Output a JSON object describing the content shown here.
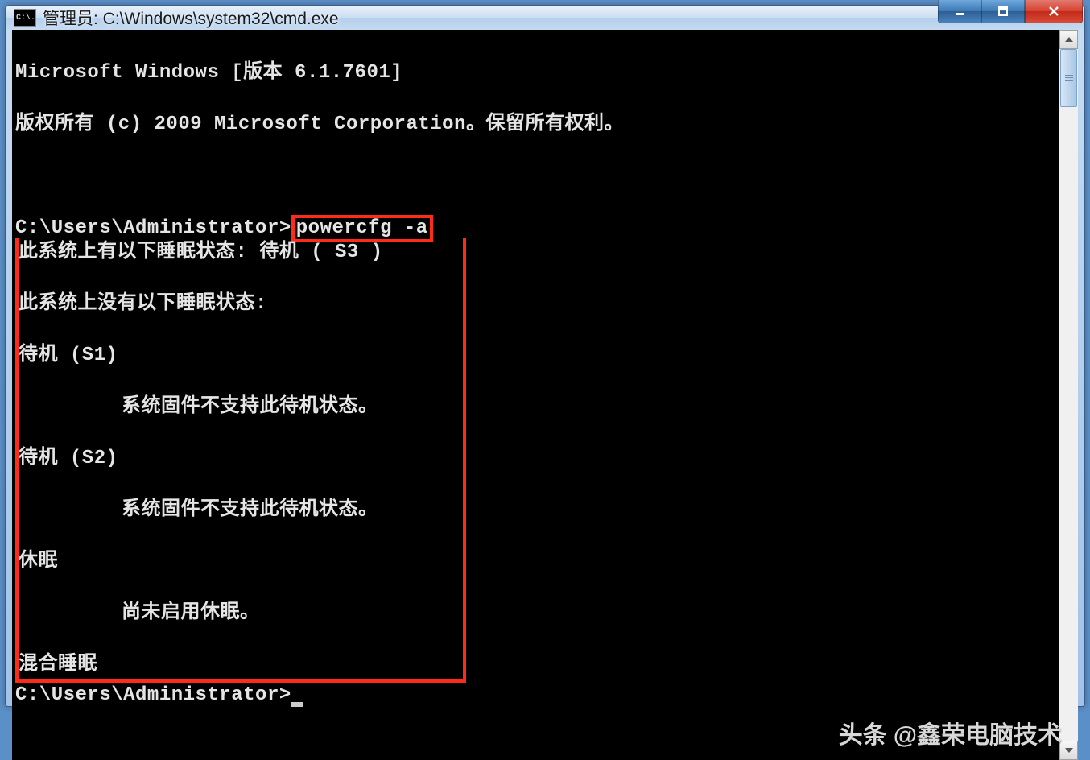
{
  "titlebar": {
    "icon_text": "C:\\.",
    "title": "管理员: C:\\Windows\\system32\\cmd.exe"
  },
  "console": {
    "line_version": "Microsoft Windows [版本 6.1.7601]",
    "line_copyright": "版权所有 (c) 2009 Microsoft Corporation。保留所有权利。",
    "prompt1_prefix": "C:\\Users\\Administrator>",
    "prompt1_command": "powercfg -a",
    "output": {
      "available_header": "此系统上有以下睡眠状态: 待机 ( S3 )",
      "unavailable_header": "此系统上没有以下睡眠状态:",
      "s1_label": "待机 (S1)",
      "s1_reason": "系统固件不支持此待机状态。",
      "s2_label": "待机 (S2)",
      "s2_reason": "系统固件不支持此待机状态。",
      "hibernate_label": "休眠",
      "hibernate_reason": "尚未启用休眠。",
      "hybrid_label": "混合睡眠"
    },
    "prompt2": "C:\\Users\\Administrator>"
  },
  "watermark": {
    "prefix": "头条",
    "text": "@鑫荣电脑技术"
  }
}
